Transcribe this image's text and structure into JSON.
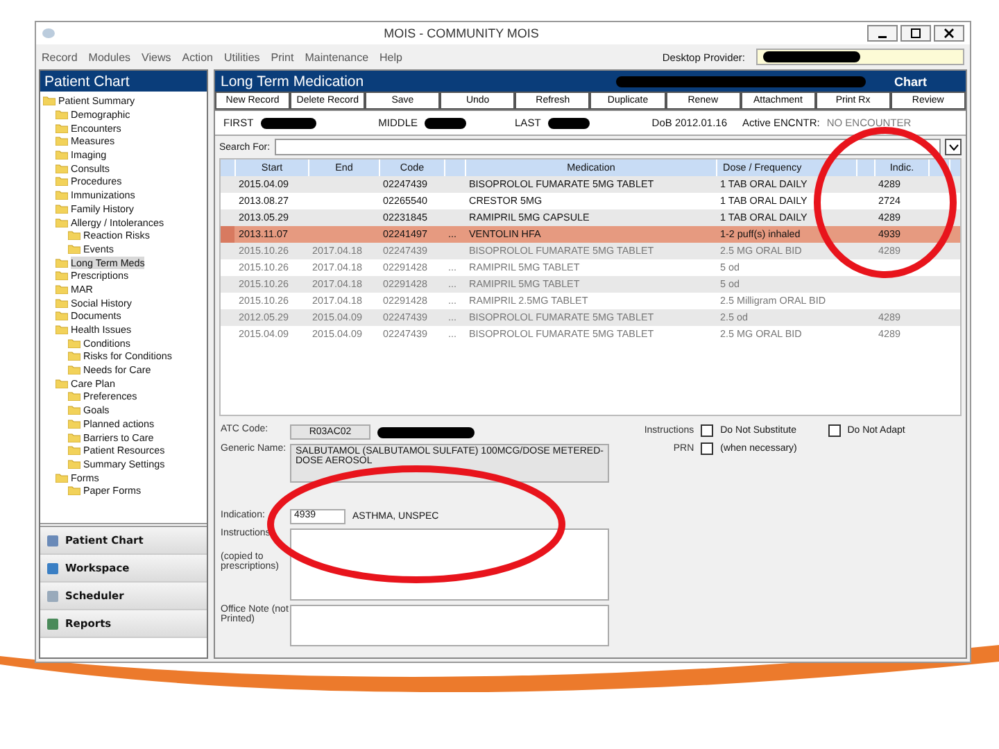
{
  "window": {
    "title": "MOIS - COMMUNITY MOIS"
  },
  "menu": [
    "Record",
    "Modules",
    "Views",
    "Action",
    "Utilities",
    "Print",
    "Maintenance",
    "Help"
  ],
  "desktop_provider": {
    "label": "Desktop Provider:"
  },
  "sidebar": {
    "title": "Patient Chart",
    "tree": [
      {
        "label": "Patient Summary",
        "selected": false,
        "children": [
          {
            "label": "Demographic",
            "selected": false
          },
          {
            "label": "Encounters",
            "selected": false
          },
          {
            "label": "Measures",
            "selected": false
          },
          {
            "label": "Imaging",
            "selected": false
          },
          {
            "label": "Consults",
            "selected": false
          },
          {
            "label": "Procedures",
            "selected": false
          },
          {
            "label": "Immunizations",
            "selected": false
          },
          {
            "label": "Family History",
            "selected": false
          },
          {
            "label": "Allergy / Intolerances",
            "selected": false,
            "children": [
              {
                "label": "Reaction Risks",
                "selected": false
              },
              {
                "label": "Events",
                "selected": false
              }
            ]
          },
          {
            "label": "Long Term Meds",
            "selected": true
          },
          {
            "label": "Prescriptions",
            "selected": false
          },
          {
            "label": "MAR",
            "selected": false
          },
          {
            "label": "Social History",
            "selected": false
          },
          {
            "label": "Documents",
            "selected": false
          },
          {
            "label": "Health Issues",
            "selected": false,
            "children": [
              {
                "label": "Conditions",
                "selected": false
              },
              {
                "label": "Risks for Conditions",
                "selected": false
              },
              {
                "label": "Needs for Care",
                "selected": false
              }
            ]
          },
          {
            "label": "Care Plan",
            "selected": false,
            "children": [
              {
                "label": "Preferences",
                "selected": false
              },
              {
                "label": "Goals",
                "selected": false
              },
              {
                "label": "Planned actions",
                "selected": false
              },
              {
                "label": "Barriers to Care",
                "selected": false
              },
              {
                "label": "Patient Resources",
                "selected": false
              },
              {
                "label": "Summary Settings",
                "selected": false
              }
            ]
          },
          {
            "label": "Forms",
            "selected": false,
            "children": [
              {
                "label": "Paper Forms",
                "selected": false
              }
            ]
          }
        ]
      }
    ],
    "nav": [
      {
        "label": "Patient Chart"
      },
      {
        "label": "Workspace"
      },
      {
        "label": "Scheduler"
      },
      {
        "label": "Reports"
      }
    ]
  },
  "main": {
    "title": "Long Term Medication",
    "chart_label": "Chart",
    "toolbar": [
      "New Record",
      "Delete Record",
      "Save",
      "Undo",
      "Refresh",
      "Duplicate",
      "Renew",
      "Attachment",
      "Print Rx",
      "Review"
    ],
    "patient": {
      "first": "FIRST",
      "middle": "MIDDLE",
      "last": "LAST",
      "dob": "DoB 2012.01.16",
      "encounter_label": "Active ENCNTR:",
      "encounter": "NO ENCOUNTER"
    },
    "search": {
      "label": "Search For:"
    },
    "table": {
      "columns": [
        "Start",
        "End",
        "Code",
        "Medication",
        "Dose / Frequency",
        "Indic."
      ],
      "rows": [
        {
          "start": "2015.04.09",
          "end": "",
          "code": "02247439",
          "lookup": "",
          "medication": "BISOPROLOL FUMARATE 5MG TABLET",
          "dose": "1 TAB ORAL DAILY",
          "indic": "4289",
          "selected": false,
          "active": true
        },
        {
          "start": "2013.08.27",
          "end": "",
          "code": "02265540",
          "lookup": "",
          "medication": "CRESTOR 5MG",
          "dose": "1 TAB ORAL DAILY",
          "indic": "2724",
          "selected": false,
          "active": true
        },
        {
          "start": "2013.05.29",
          "end": "",
          "code": "02231845",
          "lookup": "",
          "medication": "RAMIPRIL 5MG CAPSULE",
          "dose": "1 TAB ORAL DAILY",
          "indic": "4289",
          "selected": false,
          "active": true
        },
        {
          "start": "2013.11.07",
          "end": "",
          "code": "02241497",
          "lookup": "...",
          "medication": "VENTOLIN HFA",
          "dose": "1-2 puff(s) inhaled",
          "indic": "4939",
          "selected": true,
          "active": true
        },
        {
          "start": "2015.10.26",
          "end": "2017.04.18",
          "code": "02247439",
          "lookup": "",
          "medication": "BISOPROLOL FUMARATE 5MG TABLET",
          "dose": "2.5 MG ORAL BID",
          "indic": "4289",
          "selected": false,
          "active": false
        },
        {
          "start": "2015.10.26",
          "end": "2017.04.18",
          "code": "02291428",
          "lookup": "...",
          "medication": "RAMIPRIL 5MG TABLET",
          "dose": "5 od",
          "indic": "",
          "selected": false,
          "active": false
        },
        {
          "start": "2015.10.26",
          "end": "2017.04.18",
          "code": "02291428",
          "lookup": "...",
          "medication": "RAMIPRIL 5MG TABLET",
          "dose": "5 od",
          "indic": "",
          "selected": false,
          "active": false
        },
        {
          "start": "2015.10.26",
          "end": "2017.04.18",
          "code": "02291428",
          "lookup": "...",
          "medication": "RAMIPRIL 2.5MG TABLET",
          "dose": "2.5 Milligram ORAL BID",
          "indic": "",
          "selected": false,
          "active": false
        },
        {
          "start": "2012.05.29",
          "end": "2015.04.09",
          "code": "02247439",
          "lookup": "...",
          "medication": "BISOPROLOL FUMARATE 5MG TABLET",
          "dose": "2.5 od",
          "indic": "4289",
          "selected": false,
          "active": false
        },
        {
          "start": "2015.04.09",
          "end": "2015.04.09",
          "code": "02247439",
          "lookup": "...",
          "medication": "BISOPROLOL FUMARATE 5MG TABLET",
          "dose": "2.5 MG ORAL BID",
          "indic": "4289",
          "selected": false,
          "active": false
        }
      ]
    },
    "detail": {
      "atc_label": "ATC Code:",
      "atc": "R03AC02",
      "generic_label": "Generic Name:",
      "generic": "SALBUTAMOL (SALBUTAMOL SULFATE) 100MCG/DOSE METERED-DOSE AEROSOL",
      "indication_label": "Indication:",
      "indication_code": "4939",
      "indication_text": "ASTHMA, UNSPEC",
      "instructions_label": "Instructions",
      "instructions_note": "(copied to prescriptions)",
      "office_label": "Office Note (not Printed)",
      "options_label": "Instructions",
      "prn_label": "PRN",
      "checks": [
        {
          "label": "Do Not Substitute",
          "checked": false
        },
        {
          "label": "Do Not Adapt",
          "checked": false
        },
        {
          "label": "(when necessary)",
          "checked": false
        }
      ]
    }
  }
}
